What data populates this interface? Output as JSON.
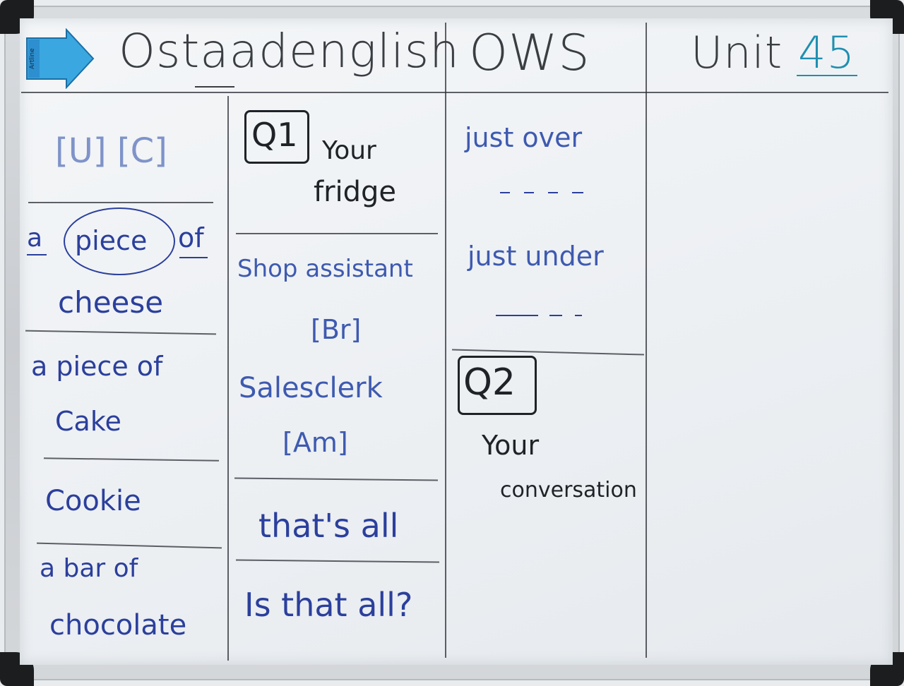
{
  "header": {
    "brand": "Ostaadenglish",
    "section": "OWS",
    "unit_label": "Unit",
    "unit_number": "45"
  },
  "magnet_label": "Artline",
  "col1": {
    "uc": "[U]   [C]",
    "a": "a",
    "piece": "piece",
    "of": "of",
    "cheese": "cheese",
    "item2_line1": "a piece of",
    "item2_line2": "Cake",
    "item3": "Cookie",
    "item4_line1": "a bar of",
    "item4_line2": "chocolate"
  },
  "col2": {
    "q1_label": "Q1",
    "q1_line1": "Your",
    "q1_line2": "fridge",
    "shop_assistant": "Shop assistant",
    "br": "[Br]",
    "salesclerk": "Salesclerk",
    "am": "[Am]",
    "thats_all": "that's all",
    "is_that_all": "Is that all?"
  },
  "col3": {
    "just_over": "just   over",
    "dashes1": "- - - -",
    "just_under": "just   under",
    "dashes2": "— — -",
    "q2_label": "Q2",
    "q2_line1": "Your",
    "q2_line2": "conversation"
  },
  "colors": {
    "marker_blue": "#2b3f9c",
    "marker_black": "#1f2226",
    "marker_teal": "#1f8fb0",
    "magnet_blue": "#3aa7e0"
  }
}
